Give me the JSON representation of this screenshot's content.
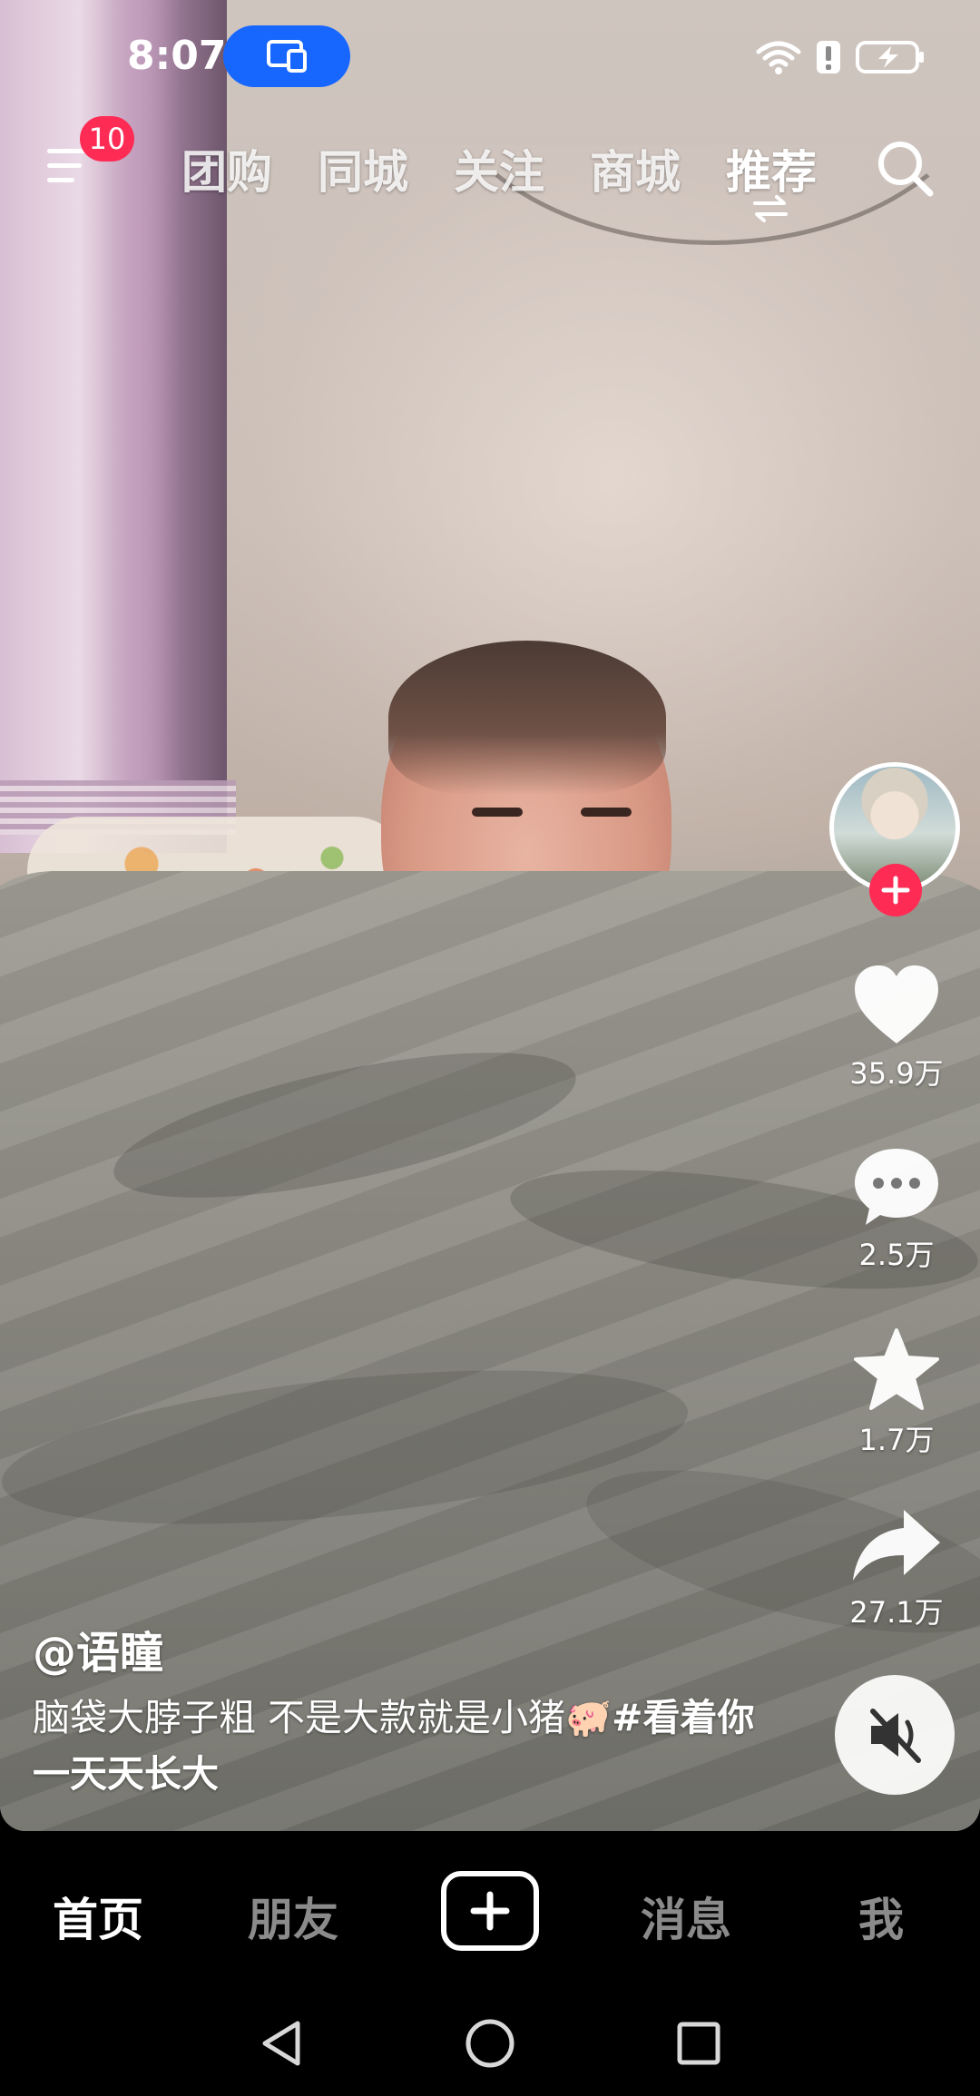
{
  "status_bar": {
    "time": "8:07",
    "icons": [
      "screen-cast-icon",
      "wifi-icon",
      "alert-icon",
      "battery-charging-icon"
    ]
  },
  "top_nav": {
    "menu_badge": "10",
    "tabs": [
      {
        "label": "团购",
        "active": false
      },
      {
        "label": "同城",
        "active": false
      },
      {
        "label": "关注",
        "active": false
      },
      {
        "label": "商城",
        "active": false
      },
      {
        "label": "推荐",
        "active": true
      }
    ],
    "icons": [
      "menu-icon",
      "switch-arrows-icon",
      "search-icon"
    ]
  },
  "side_rail": {
    "likes": "35.9万",
    "comments": "2.5万",
    "favorites": "1.7万",
    "shares": "27.1万",
    "icons": [
      "avatar",
      "follow-plus-icon",
      "heart-icon",
      "comment-icon",
      "star-icon",
      "share-icon",
      "mute-icon"
    ]
  },
  "video": {
    "author": "@语瞳",
    "caption": "脑袋大脖子粗 不是大款就是小猪🐖",
    "hashtag": "#看着你一天天长大"
  },
  "bottom_nav": {
    "tabs": [
      {
        "label": "首页",
        "active": true
      },
      {
        "label": "朋友",
        "active": false
      },
      {
        "label": "消息",
        "active": false
      },
      {
        "label": "我",
        "active": false
      }
    ],
    "create_icon": "plus-icon"
  },
  "system_nav": [
    "back-icon",
    "home-icon",
    "recents-icon"
  ],
  "colors": {
    "accent": "#fe2c55",
    "cast_pill": "#1767ff",
    "bar_background": "#000000"
  }
}
